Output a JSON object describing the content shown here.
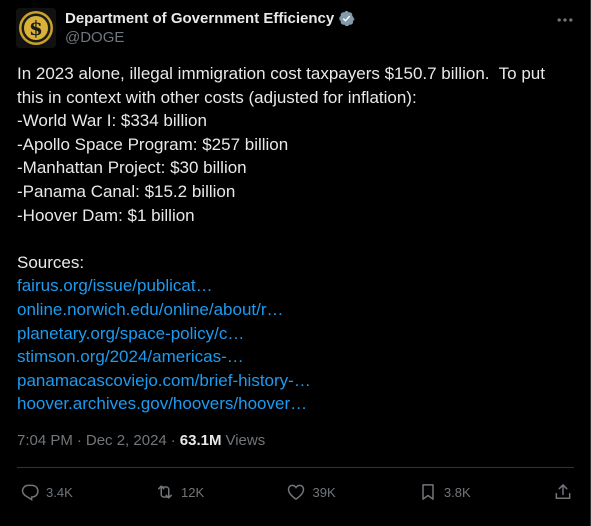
{
  "author": {
    "name": "Department of Government Efficiency",
    "handle": "@DOGE",
    "verified_color": "#829aab"
  },
  "body": {
    "lines": [
      "In 2023 alone, illegal immigration cost taxpayers $150.7 billion.  To put",
      "this in context with other costs (adjusted for inflation):",
      "-World War I: $334 billion",
      "-Apollo Space Program: $257 billion",
      "-Manhattan Project: $30 billion",
      "-Panama Canal: $15.2 billion",
      "-Hoover Dam: $1 billion"
    ],
    "sources_label": "Sources:",
    "links": [
      "fairus.org/issue/publicat…",
      "online.norwich.edu/online/about/r…",
      "planetary.org/space-policy/c…",
      "stimson.org/2024/americas-…",
      "panamacascoviejo.com/brief-history-…",
      "hoover.archives.gov/hoovers/hoover…"
    ]
  },
  "meta": {
    "time": "7:04 PM",
    "separator": "·",
    "date": "Dec 2, 2024",
    "views_count": "63.1M",
    "views_label": "Views"
  },
  "actions": {
    "replies": "3.4K",
    "reposts": "12K",
    "likes": "39K",
    "bookmarks": "3.8K"
  },
  "colors": {
    "background": "#000000",
    "text": "#e7e9ea",
    "muted": "#71767b",
    "link": "#1d9bf0",
    "border": "#2f3336"
  }
}
